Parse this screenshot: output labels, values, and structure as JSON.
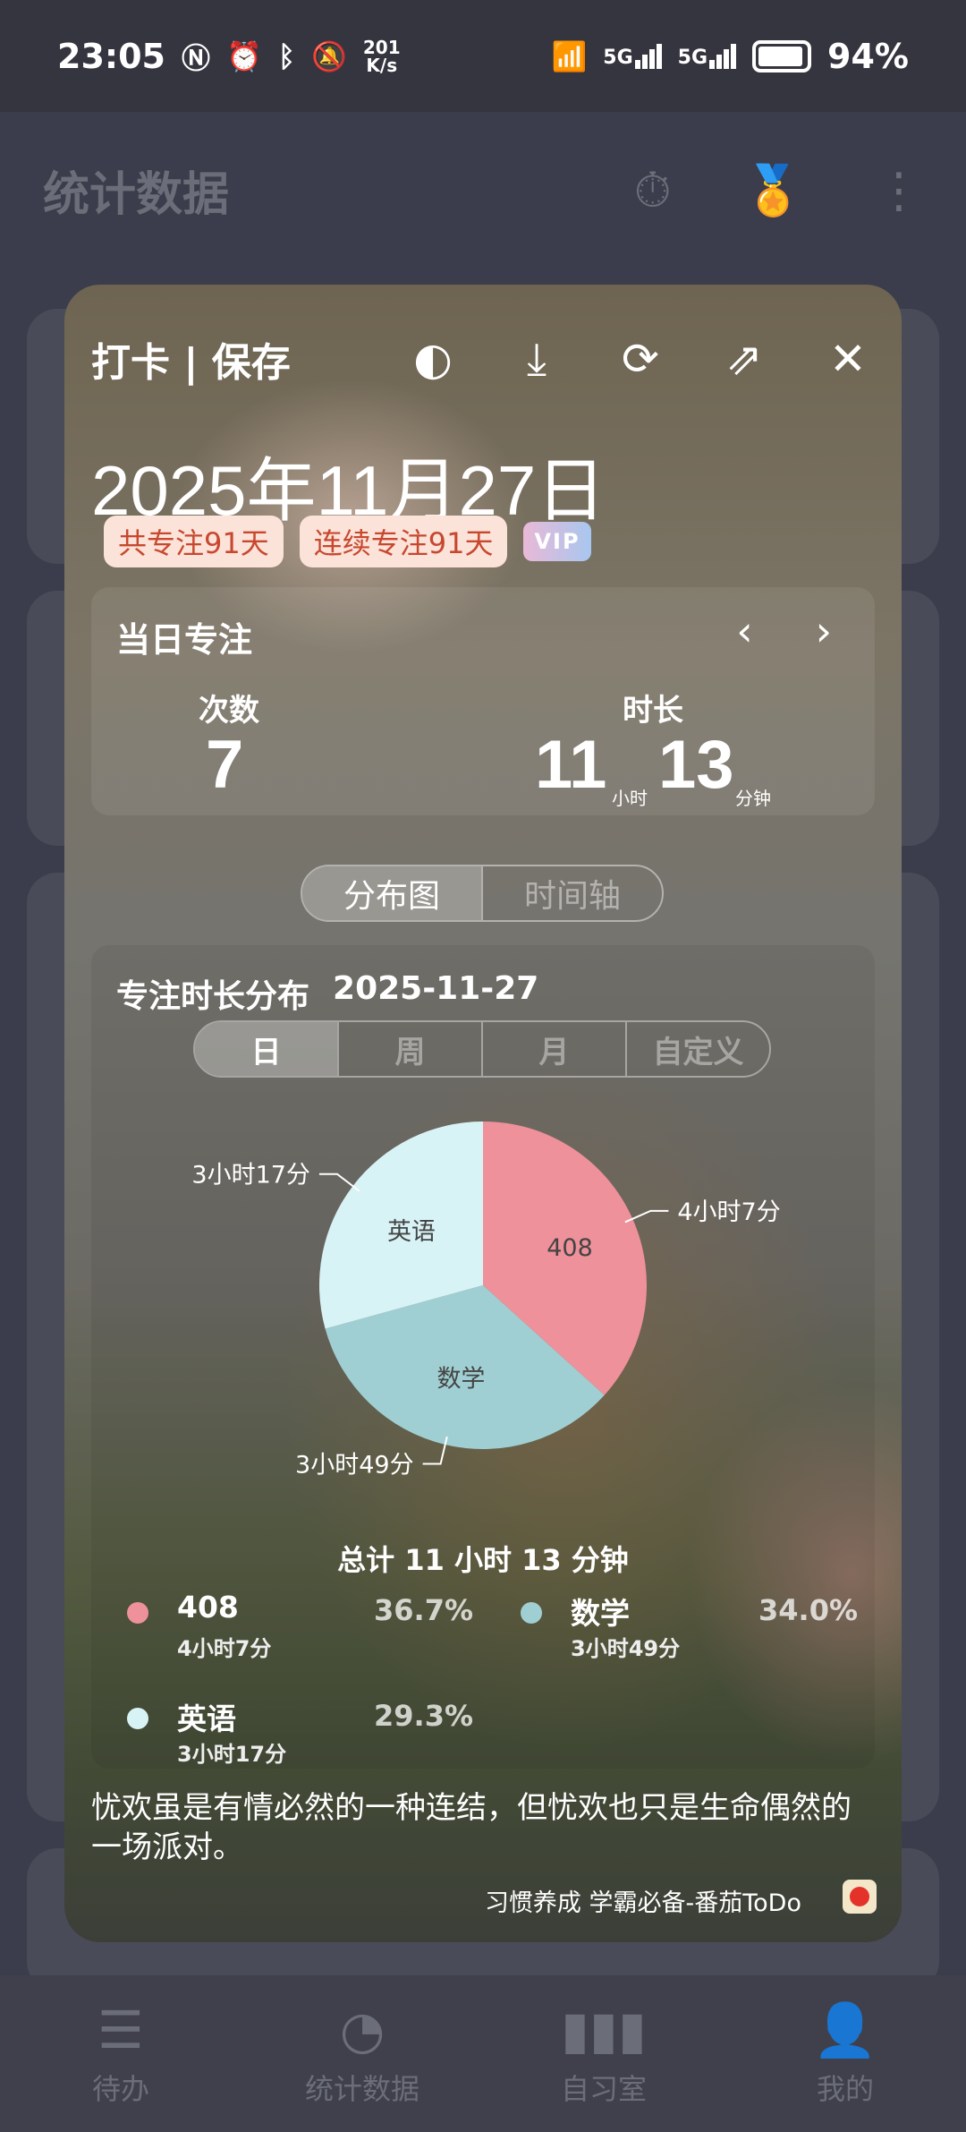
{
  "status_bar": {
    "time": "23:05",
    "net_speed_value": "201",
    "net_speed_unit": "K/s",
    "battery": "94%"
  },
  "app": {
    "title": "统计数据",
    "nav": [
      {
        "label": "待办",
        "icon": "list-icon"
      },
      {
        "label": "统计数据",
        "icon": "pie-chart-icon"
      },
      {
        "label": "自习室",
        "icon": "bar-chart-icon"
      },
      {
        "label": "我的",
        "icon": "person-icon"
      }
    ]
  },
  "card": {
    "title": "打卡 | 保存",
    "date": "2025年11月27日",
    "tags": [
      "共专注91天",
      "连续专注91天"
    ],
    "vip": "VIP",
    "daily": {
      "title": "当日专注",
      "count_label": "次数",
      "count_value": "7",
      "duration_label": "时长",
      "hours": "11",
      "hours_unit": "小时",
      "minutes": "13",
      "minutes_unit": "分钟"
    },
    "view_tabs": [
      "分布图",
      "时间轴"
    ],
    "distribution": {
      "title": "专注时长分布",
      "date": "2025-11-27",
      "ranges": [
        "日",
        "周",
        "月",
        "自定义"
      ],
      "total": "总计 11 小时 13 分钟",
      "legend": [
        {
          "name": "408",
          "duration": "4小时7分",
          "percent": "36.7%"
        },
        {
          "name": "数学",
          "duration": "3小时49分",
          "percent": "34.0%"
        },
        {
          "name": "英语",
          "duration": "3小时17分",
          "percent": "29.3%"
        }
      ]
    },
    "quote": "忧欢虽是有情必然的一种连结，但忧欢也只是生命偶然的一场派对。",
    "footer": "习惯养成 学霸必备-番茄ToDo"
  },
  "chart_data": {
    "type": "pie",
    "categories": [
      "408",
      "数学",
      "英语"
    ],
    "values": [
      247,
      229,
      197
    ],
    "value_labels": [
      "4小时7分",
      "3小时49分",
      "3小时17分"
    ],
    "colors": [
      "#ee919b",
      "#a0cfd3",
      "#d8f3f6"
    ]
  }
}
